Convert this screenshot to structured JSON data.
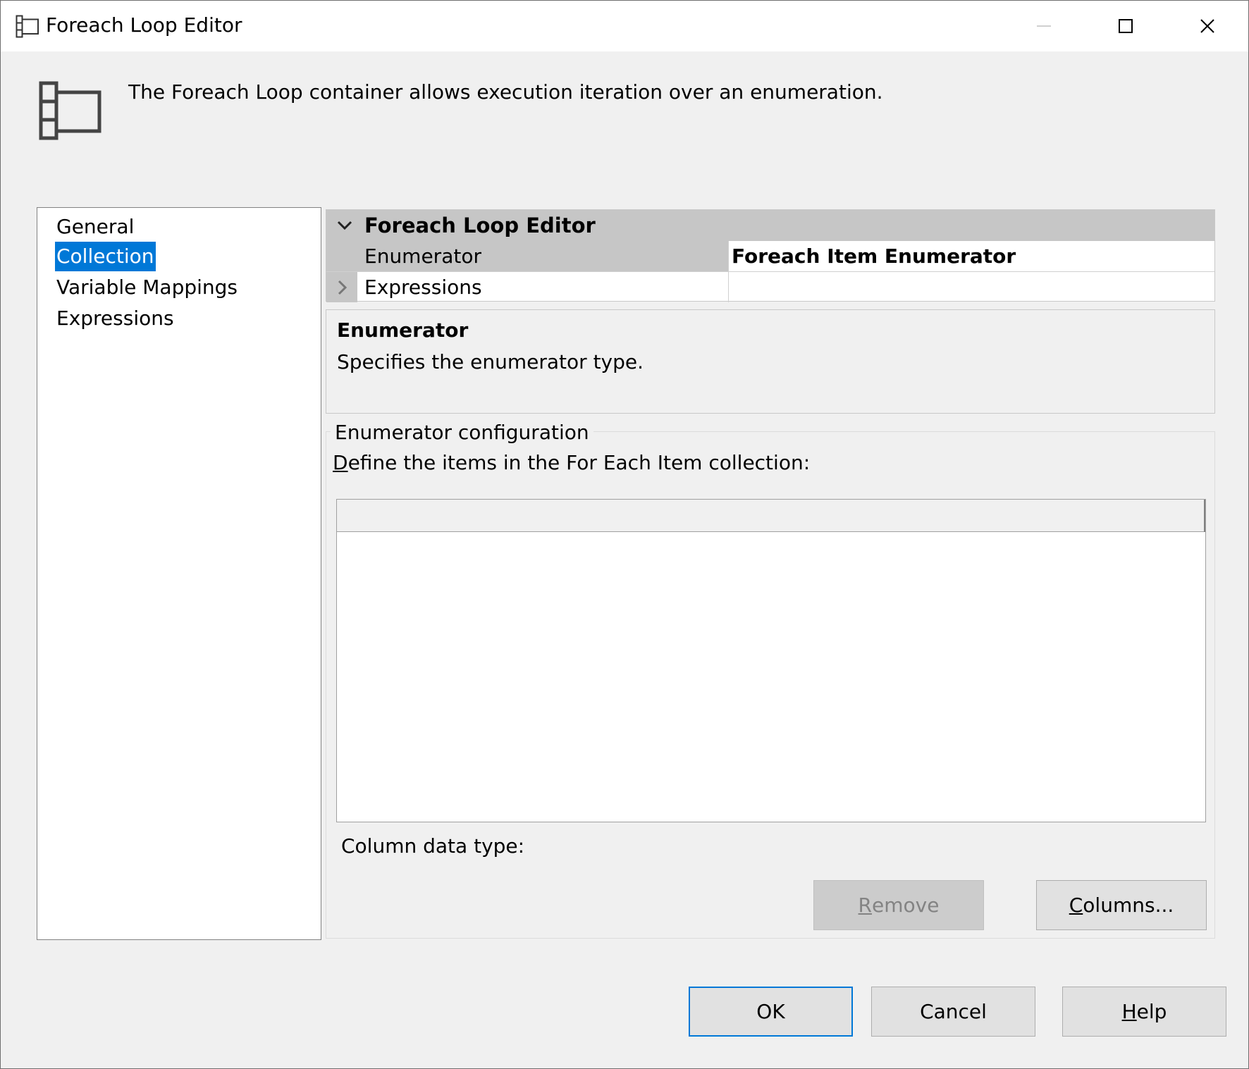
{
  "window": {
    "title": "Foreach Loop Editor",
    "title_icon": "foreach-loop-icon",
    "controls": [
      "minimize-icon",
      "maximize-icon",
      "close-icon"
    ]
  },
  "header": {
    "icon": "foreach-loop-icon",
    "description": "The Foreach Loop container allows execution iteration over an enumeration."
  },
  "nav": {
    "items": [
      {
        "label": "General",
        "selected": false
      },
      {
        "label": "Collection",
        "selected": true
      },
      {
        "label": "Variable Mappings",
        "selected": false
      },
      {
        "label": "Expressions",
        "selected": false
      }
    ]
  },
  "property_grid": {
    "category": "Foreach Loop Editor",
    "rows": [
      {
        "name": "Enumerator",
        "value": "Foreach Item Enumerator"
      },
      {
        "name": "Expressions",
        "value": ""
      }
    ]
  },
  "description_panel": {
    "title": "Enumerator",
    "text": "Specifies the enumerator type."
  },
  "config": {
    "legend": "Enumerator configuration",
    "define_label_first": "D",
    "define_label_rest": "efine the items in the For Each Item collection:",
    "column_type_label": "Column data type:",
    "remove_first": "R",
    "remove_rest": "emove",
    "columns_first": "C",
    "columns_rest": "olumns..."
  },
  "footer": {
    "ok": "OK",
    "cancel": "Cancel",
    "help_first": "H",
    "help_rest": "elp"
  },
  "colors": {
    "selection": "#0078d7",
    "grid_category": "#c6c6c6",
    "dialog_bg": "#f0f0f0"
  }
}
